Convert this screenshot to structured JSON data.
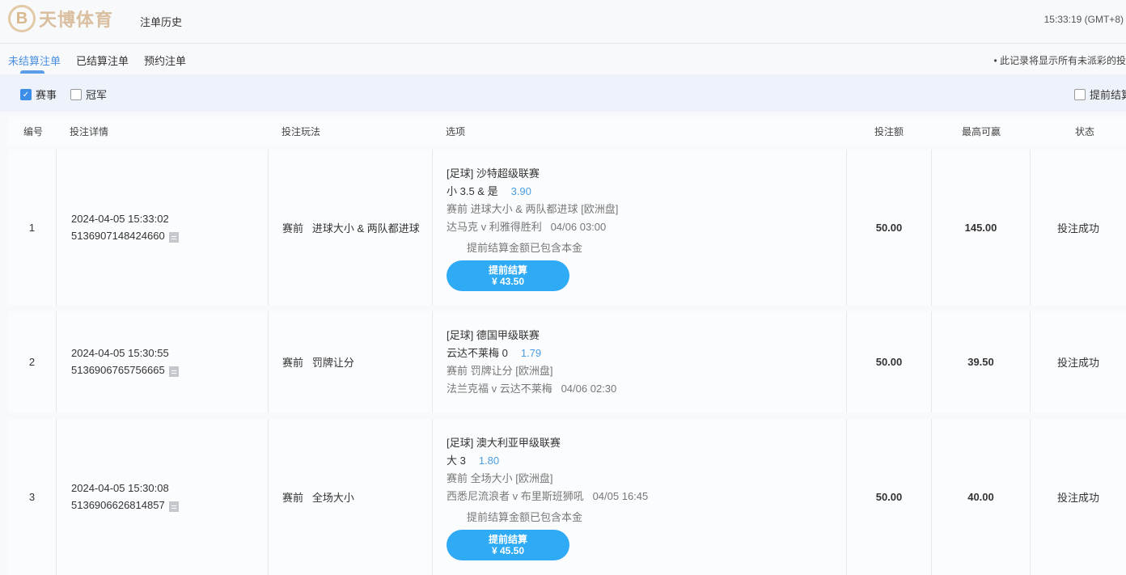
{
  "header": {
    "logo_mark": "B",
    "logo_text": "天博体育",
    "title": "注单历史",
    "clock": "15:33:19 (GMT+8)"
  },
  "tabs": [
    {
      "label": "未结算注单"
    },
    {
      "label": "已结算注单"
    },
    {
      "label": "预约注单"
    }
  ],
  "notice": "• 此记录将显示所有未派彩的投",
  "filters": {
    "match": "赛事",
    "outright": "冠军",
    "cashout": "提前结算"
  },
  "columns": [
    "编号",
    "投注详情",
    "投注玩法",
    "选项",
    "投注额",
    "最高可赢",
    "状态"
  ],
  "rows": [
    {
      "no": "1",
      "time": "2024-04-05 15:33:02",
      "id": "5136907148424660",
      "play": "赛前   进球大小 & 两队都进球",
      "league": "[足球] 沙特超级联赛",
      "pick": "小 3.5 & 是",
      "odds": "3.90",
      "market": "赛前 进球大小 & 两队都进球 [欧洲盘]",
      "match": "达马克 v 利雅得胜利",
      "kickoff": "04/06 03:00",
      "cashout_note": "提前结算金额已包含本金",
      "cashout_label": "提前结算",
      "cashout_amount": "¥ 43.50",
      "stake": "50.00",
      "max_win": "145.00",
      "status": "投注成功"
    },
    {
      "no": "2",
      "time": "2024-04-05 15:30:55",
      "id": "5136906765756665",
      "play": "赛前   罚牌让分",
      "league": "[足球] 德国甲级联赛",
      "pick": "云达不莱梅 0",
      "odds": "1.79",
      "market": "赛前 罚牌让分 [欧洲盘]",
      "match": "法兰克福 v 云达不莱梅",
      "kickoff": "04/06 02:30",
      "stake": "50.00",
      "max_win": "39.50",
      "status": "投注成功"
    },
    {
      "no": "3",
      "time": "2024-04-05 15:30:08",
      "id": "5136906626814857",
      "play": "赛前   全场大小",
      "league": "[足球] 澳大利亚甲级联赛",
      "pick": "大 3",
      "odds": "1.80",
      "market": "赛前 全场大小 [欧洲盘]",
      "match": "西悉尼流浪者 v 布里斯班狮吼",
      "kickoff": "04/05 16:45",
      "cashout_note": "提前结算金额已包含本金",
      "cashout_label": "提前结算",
      "cashout_amount": "¥ 45.50",
      "stake": "50.00",
      "max_win": "40.00",
      "status": "投注成功"
    }
  ]
}
